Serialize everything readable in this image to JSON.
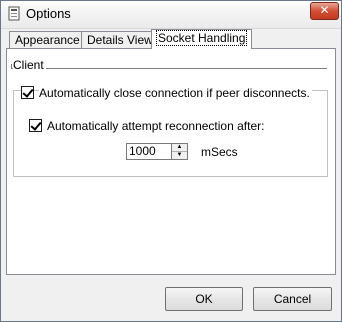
{
  "window": {
    "title": "Options"
  },
  "tabs": [
    {
      "label": "Appearance"
    },
    {
      "label": "Details View"
    },
    {
      "label": "Socket Handling",
      "active": true
    }
  ],
  "client_group": {
    "label": "Client",
    "auto_close": {
      "label": "Automatically close connection if peer disconnects.",
      "checked": true
    },
    "auto_reconnect": {
      "label": "Automatically attempt reconnection after:",
      "checked": true
    },
    "reconnect_delay": {
      "value": "1000",
      "unit": "mSecs"
    }
  },
  "buttons": {
    "ok": "OK",
    "cancel": "Cancel"
  },
  "icons": {
    "app": "app-window-icon",
    "close": "close-icon",
    "spin_up": "arrow-up-icon",
    "spin_down": "arrow-down-icon"
  }
}
